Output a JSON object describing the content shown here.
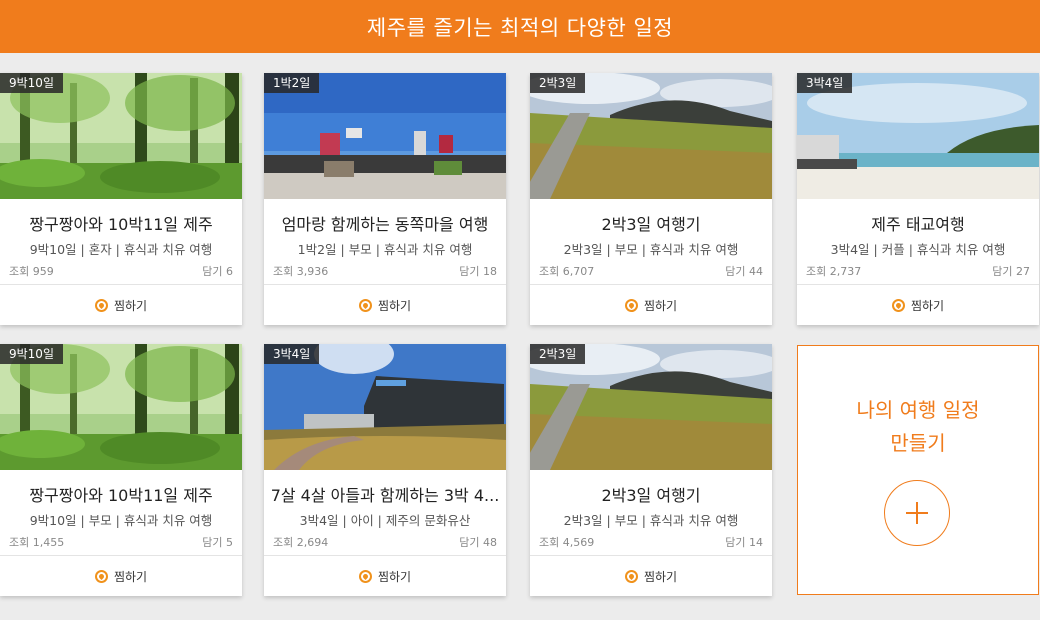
{
  "banner": {
    "title": "제주를 즐기는 최적의 다양한 일정"
  },
  "cards": [
    {
      "badge": "9박10일",
      "title": "짱구짱아와 10박11일 제주",
      "sub": "9박10일 | 혼자 | 휴식과 치유 여행",
      "views": "조회 959",
      "saves": "담기 6",
      "wish": "찜하기",
      "image": "forest"
    },
    {
      "badge": "1박2일",
      "title": "엄마랑 함께하는 동쪽마을 여행",
      "sub": "1박2일 | 부모 | 휴식과 치유 여행",
      "views": "조회 3,936",
      "saves": "담기 18",
      "wish": "찜하기",
      "image": "seaside"
    },
    {
      "badge": "2박3일",
      "title": "2박3일 여행기",
      "sub": "2박3일 | 부모 | 휴식과 치유 여행",
      "views": "조회 6,707",
      "saves": "담기 44",
      "wish": "찜하기",
      "image": "oreum"
    },
    {
      "badge": "3박4일",
      "title": "제주 태교여행",
      "sub": "3박4일 | 커플 | 휴식과 치유 여행",
      "views": "조회 2,737",
      "saves": "담기 27",
      "wish": "찜하기",
      "image": "beach"
    },
    {
      "badge": "9박10일",
      "title": "짱구짱아와 10박11일 제주",
      "sub": "9박10일 | 부모 | 휴식과 치유 여행",
      "views": "조회 1,455",
      "saves": "담기 5",
      "wish": "찜하기",
      "image": "forest"
    },
    {
      "badge": "3박4일",
      "title": "7살 4살 아들과 함께하는 3박 4...",
      "sub": "3박4일 | 아이 | 제주의 문화유산",
      "views": "조회 2,694",
      "saves": "담기 48",
      "wish": "찜하기",
      "image": "museum"
    },
    {
      "badge": "2박3일",
      "title": "2박3일 여행기",
      "sub": "2박3일 | 부모 | 휴식과 치유 여행",
      "views": "조회 4,569",
      "saves": "담기 14",
      "wish": "찜하기",
      "image": "oreum"
    }
  ],
  "make": {
    "line1": "나의 여행 일정",
    "line2": "만들기",
    "icon": "plus-icon"
  },
  "colors": {
    "accent": "#f07c1c",
    "background": "#ececec"
  }
}
